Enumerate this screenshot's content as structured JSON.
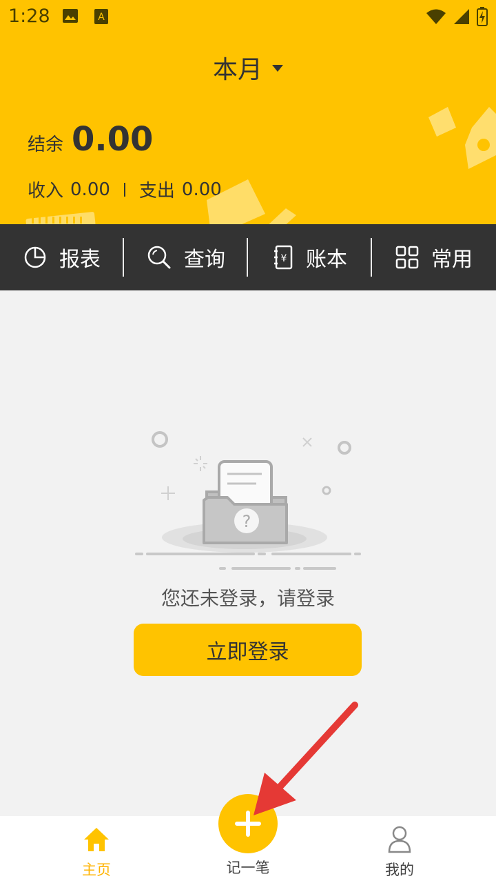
{
  "status_bar": {
    "time": "1:28"
  },
  "header": {
    "month_selector": "本月",
    "balance_label": "结余",
    "balance_value": "0.00",
    "income_label": "收入",
    "income_value": "0.00",
    "expense_label": "支出",
    "expense_value": "0.00",
    "background_color": "#FFC300"
  },
  "toolbar": {
    "items": [
      {
        "label": "报表",
        "icon": "pie-chart-icon"
      },
      {
        "label": "查询",
        "icon": "search-icon"
      },
      {
        "label": "账本",
        "icon": "ledger-book-icon"
      },
      {
        "label": "常用",
        "icon": "grid-icon"
      }
    ]
  },
  "empty_state": {
    "icon": "folder-question-icon",
    "message": "您还未登录，请登录",
    "login_button": "立即登录"
  },
  "bottom_nav": {
    "home_label": "主页",
    "add_label": "记一笔",
    "mine_label": "我的",
    "active_color": "#FFB300"
  },
  "annotation": {
    "icon": "red-arrow-icon",
    "color": "#E53935"
  }
}
